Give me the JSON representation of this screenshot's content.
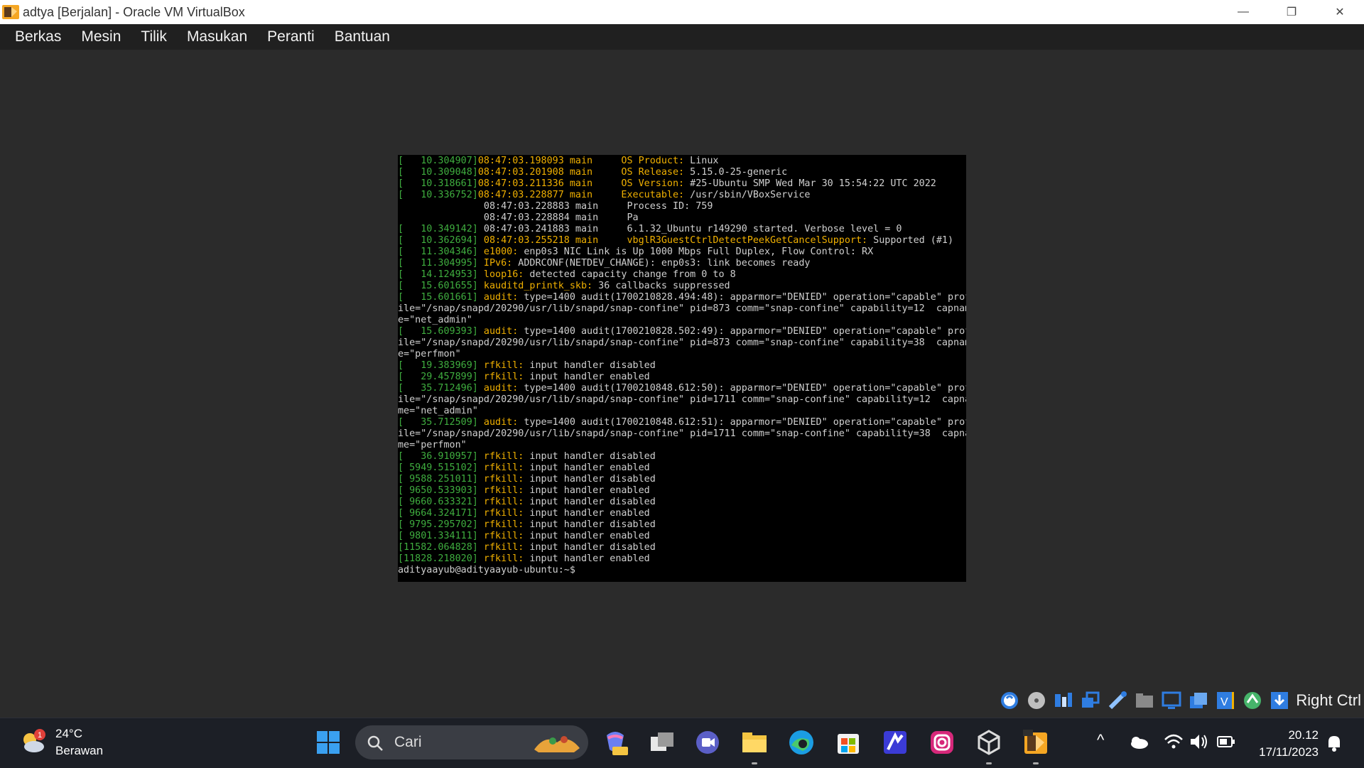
{
  "window": {
    "title": "adtya [Berjalan] - Oracle VM VirtualBox",
    "minimize_glyph": "—",
    "restore_glyph": "❐",
    "close_glyph": "✕"
  },
  "menu": [
    "Berkas",
    "Mesin",
    "Tilik",
    "Masukan",
    "Peranti",
    "Bantuan"
  ],
  "terminal": {
    "lines": [
      {
        "ts": "[   10.304907]",
        "rest": [
          [
            "kw",
            "08:47:03.198093 main     OS Product:"
          ],
          [
            "dim",
            " Linux"
          ]
        ]
      },
      {
        "ts": "[   10.309048]",
        "rest": [
          [
            "kw",
            "08:47:03.201908 main     OS Release:"
          ],
          [
            "dim",
            " 5.15.0-25-generic"
          ]
        ]
      },
      {
        "ts": "[   10.318661]",
        "rest": [
          [
            "kw",
            "08:47:03.211336 main     OS Version:"
          ],
          [
            "dim",
            " #25-Ubuntu SMP Wed Mar 30 15:54:22 UTC 2022"
          ]
        ]
      },
      {
        "ts": "[   10.336752]",
        "rest": [
          [
            "kw",
            "08:47:03.228877 main     Executable:"
          ],
          [
            "dim",
            " /usr/sbin/VBoxService"
          ]
        ]
      },
      {
        "ts": "              ",
        "rest": [
          [
            "dim",
            " 08:47:03.228883 main     Process ID: 759"
          ]
        ]
      },
      {
        "ts": "              ",
        "rest": [
          [
            "dim",
            " 08:47:03.228884 main     Pa"
          ]
        ]
      },
      {
        "ts": "[   10.349142]",
        "rest": [
          [
            "dim",
            " 08:47:03.241883 main     6.1.32_Ubuntu r149290 started. Verbose level = 0"
          ]
        ]
      },
      {
        "ts": "[   10.362694]",
        "rest": [
          [
            "kw",
            " 08:47:03.255218 main     vbglR3GuestCtrlDetectPeekGetCancelSupport:"
          ],
          [
            "dim",
            " Supported (#1)"
          ]
        ]
      },
      {
        "ts": "[   11.304346]",
        "rest": [
          [
            "kw",
            " e1000:"
          ],
          [
            "dim",
            " enp0s3 NIC Link is Up 1000 Mbps Full Duplex, Flow Control: RX"
          ]
        ]
      },
      {
        "ts": "[   11.304995]",
        "rest": [
          [
            "kw",
            " IPv6:"
          ],
          [
            "dim",
            " ADDRCONF(NETDEV_CHANGE): enp0s3: link becomes ready"
          ]
        ]
      },
      {
        "ts": "[   14.124953]",
        "rest": [
          [
            "kw",
            " loop16:"
          ],
          [
            "dim",
            " detected capacity change from 0 to 8"
          ]
        ]
      },
      {
        "ts": "[   15.601655]",
        "rest": [
          [
            "kw",
            " kauditd_printk_skb:"
          ],
          [
            "dim",
            " 36 callbacks suppressed"
          ]
        ]
      },
      {
        "ts": "[   15.601661]",
        "rest": [
          [
            "kw",
            " audit:"
          ],
          [
            "dim",
            " type=1400 audit(1700210828.494:48): apparmor=\"DENIED\" operation=\"capable\" prof"
          ]
        ]
      },
      {
        "ts": "",
        "rest": [
          [
            "dim",
            "ile=\"/snap/snapd/20290/usr/lib/snapd/snap-confine\" pid=873 comm=\"snap-confine\" capability=12  capnam"
          ]
        ]
      },
      {
        "ts": "",
        "rest": [
          [
            "dim",
            "e=\"net_admin\""
          ]
        ]
      },
      {
        "ts": "[   15.609393]",
        "rest": [
          [
            "kw",
            " audit:"
          ],
          [
            "dim",
            " type=1400 audit(1700210828.502:49): apparmor=\"DENIED\" operation=\"capable\" prof"
          ]
        ]
      },
      {
        "ts": "",
        "rest": [
          [
            "dim",
            "ile=\"/snap/snapd/20290/usr/lib/snapd/snap-confine\" pid=873 comm=\"snap-confine\" capability=38  capnam"
          ]
        ]
      },
      {
        "ts": "",
        "rest": [
          [
            "dim",
            "e=\"perfmon\""
          ]
        ]
      },
      {
        "ts": "[   19.383969]",
        "rest": [
          [
            "kw",
            " rfkill:"
          ],
          [
            "dim",
            " input handler disabled"
          ]
        ]
      },
      {
        "ts": "[   29.457899]",
        "rest": [
          [
            "kw",
            " rfkill:"
          ],
          [
            "dim",
            " input handler enabled"
          ]
        ]
      },
      {
        "ts": "[   35.712496]",
        "rest": [
          [
            "kw",
            " audit:"
          ],
          [
            "dim",
            " type=1400 audit(1700210848.612:50): apparmor=\"DENIED\" operation=\"capable\" prof"
          ]
        ]
      },
      {
        "ts": "",
        "rest": [
          [
            "dim",
            "ile=\"/snap/snapd/20290/usr/lib/snapd/snap-confine\" pid=1711 comm=\"snap-confine\" capability=12  capna"
          ]
        ]
      },
      {
        "ts": "",
        "rest": [
          [
            "dim",
            "me=\"net_admin\""
          ]
        ]
      },
      {
        "ts": "[   35.712509]",
        "rest": [
          [
            "kw",
            " audit:"
          ],
          [
            "dim",
            " type=1400 audit(1700210848.612:51): apparmor=\"DENIED\" operation=\"capable\" prof"
          ]
        ]
      },
      {
        "ts": "",
        "rest": [
          [
            "dim",
            "ile=\"/snap/snapd/20290/usr/lib/snapd/snap-confine\" pid=1711 comm=\"snap-confine\" capability=38  capna"
          ]
        ]
      },
      {
        "ts": "",
        "rest": [
          [
            "dim",
            "me=\"perfmon\""
          ]
        ]
      },
      {
        "ts": "[   36.910957]",
        "rest": [
          [
            "kw",
            " rfkill:"
          ],
          [
            "dim",
            " input handler disabled"
          ]
        ]
      },
      {
        "ts": "[ 5949.515102]",
        "rest": [
          [
            "kw",
            " rfkill:"
          ],
          [
            "dim",
            " input handler enabled"
          ]
        ]
      },
      {
        "ts": "[ 9588.251011]",
        "rest": [
          [
            "kw",
            " rfkill:"
          ],
          [
            "dim",
            " input handler disabled"
          ]
        ]
      },
      {
        "ts": "[ 9650.533903]",
        "rest": [
          [
            "kw",
            " rfkill:"
          ],
          [
            "dim",
            " input handler enabled"
          ]
        ]
      },
      {
        "ts": "[ 9660.633321]",
        "rest": [
          [
            "kw",
            " rfkill:"
          ],
          [
            "dim",
            " input handler disabled"
          ]
        ]
      },
      {
        "ts": "[ 9664.324171]",
        "rest": [
          [
            "kw",
            " rfkill:"
          ],
          [
            "dim",
            " input handler enabled"
          ]
        ]
      },
      {
        "ts": "[ 9795.295702]",
        "rest": [
          [
            "kw",
            " rfkill:"
          ],
          [
            "dim",
            " input handler disabled"
          ]
        ]
      },
      {
        "ts": "[ 9801.334111]",
        "rest": [
          [
            "kw",
            " rfkill:"
          ],
          [
            "dim",
            " input handler enabled"
          ]
        ]
      },
      {
        "ts": "[11582.064828]",
        "rest": [
          [
            "kw",
            " rfkill:"
          ],
          [
            "dim",
            " input handler disabled"
          ]
        ]
      },
      {
        "ts": "[11828.218020]",
        "rest": [
          [
            "kw",
            " rfkill:"
          ],
          [
            "dim",
            " input handler enabled"
          ]
        ]
      },
      {
        "ts": "",
        "rest": [
          [
            "dim",
            "adityaayub@adityaayub-ubuntu:~$ "
          ]
        ]
      }
    ]
  },
  "status_bar": {
    "icons": [
      "hard-disk-icon",
      "optical-drive-icon",
      "audio-icon",
      "network-icon",
      "usb-icon",
      "shared-folders-icon",
      "display-icon",
      "recording-icon",
      "vt-x-icon",
      "mouse-integration-icon",
      "keyboard-capture-icon"
    ],
    "host_key": "Right Ctrl"
  },
  "taskbar": {
    "weather": {
      "temp": "24°C",
      "condition": "Berawan",
      "badge": "1"
    },
    "search_label": "Cari",
    "apps": [
      "start-icon",
      "copilot-icon",
      "task-view-icon",
      "teams-icon",
      "file-explorer-icon",
      "edge-icon",
      "store-icon",
      "app-icon",
      "instagram-icon",
      "virtualbox-icon",
      "virtualbox-vm-icon"
    ],
    "tray": {
      "time": "20.12",
      "date": "17/11/2023",
      "chevron": "^"
    }
  },
  "colors": {
    "timestamp": "#3fae3f",
    "keyword": "#f0b000",
    "text": "#d0d0d0",
    "accent_blue": "#2f7de1"
  }
}
